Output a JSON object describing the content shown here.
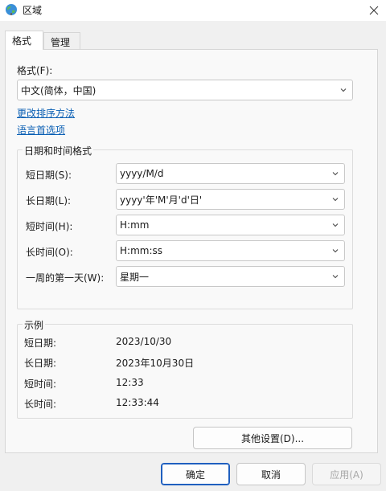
{
  "window": {
    "title": "区域"
  },
  "tabs": [
    {
      "label": "格式"
    },
    {
      "label": "管理"
    }
  ],
  "format": {
    "label": "格式(F):",
    "value": "中文(简体，中国)"
  },
  "links": {
    "sort": "更改排序方法",
    "language": "语言首选项"
  },
  "datetime_group": {
    "title": "日期和时间格式",
    "rows": [
      {
        "label": "短日期(S):",
        "value": "yyyy/M/d"
      },
      {
        "label": "长日期(L):",
        "value": "yyyy'年'M'月'd'日'"
      },
      {
        "label": "短时间(H):",
        "value": "H:mm"
      },
      {
        "label": "长时间(O):",
        "value": "H:mm:ss"
      },
      {
        "label": "一周的第一天(W):",
        "value": "星期一"
      }
    ]
  },
  "example_group": {
    "title": "示例",
    "rows": [
      {
        "label": "短日期:",
        "value": "2023/10/30"
      },
      {
        "label": "长日期:",
        "value": "2023年10月30日"
      },
      {
        "label": "短时间:",
        "value": "12:33"
      },
      {
        "label": "长时间:",
        "value": "12:33:44"
      }
    ]
  },
  "buttons": {
    "other": "其他设置(D)...",
    "ok": "确定",
    "cancel": "取消",
    "apply": "应用(A)"
  },
  "icons": {
    "title": "globe-icon",
    "close": "close-icon",
    "dropdown": "chevron-down-icon"
  },
  "colors": {
    "link": "#0a5fb4",
    "primary_border": "#1f5fbf",
    "panel": "#f9f9f9"
  }
}
